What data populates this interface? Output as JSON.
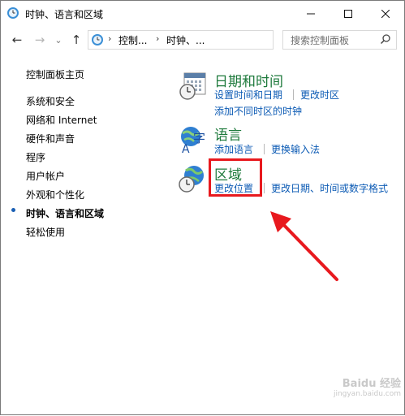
{
  "window": {
    "title": "时钟、语言和区域",
    "minimize_label": "—",
    "maximize_label": "☐",
    "close_label": "✕"
  },
  "navbar": {
    "back": "←",
    "forward": "→",
    "recent": "⌄",
    "up": "↑",
    "breadcrumbs": [
      "控制...",
      "时钟、..."
    ],
    "refresh": "↻"
  },
  "search": {
    "placeholder": "搜索控制面板"
  },
  "sidebar": {
    "items": [
      {
        "label": "控制面板主页"
      },
      {
        "label": "系统和安全"
      },
      {
        "label": "网络和 Internet"
      },
      {
        "label": "硬件和声音"
      },
      {
        "label": "程序"
      },
      {
        "label": "用户帐户"
      },
      {
        "label": "外观和个性化"
      },
      {
        "label": "时钟、语言和区域"
      },
      {
        "label": "轻松使用"
      }
    ]
  },
  "categories": {
    "datetime": {
      "title": "日期和时间",
      "links": [
        "设置时间和日期",
        "更改时区",
        "添加不同时区的时钟"
      ]
    },
    "language": {
      "title": "语言",
      "links": [
        "添加语言",
        "更换输入法"
      ]
    },
    "region": {
      "title": "区域",
      "links": [
        "更改位置",
        "更改日期、时间或数字格式"
      ]
    }
  },
  "annotation": {
    "highlight_color": "#e8191e"
  },
  "watermark": {
    "text": "Baidu 经验",
    "sub": "jingyan.baidu.com"
  }
}
